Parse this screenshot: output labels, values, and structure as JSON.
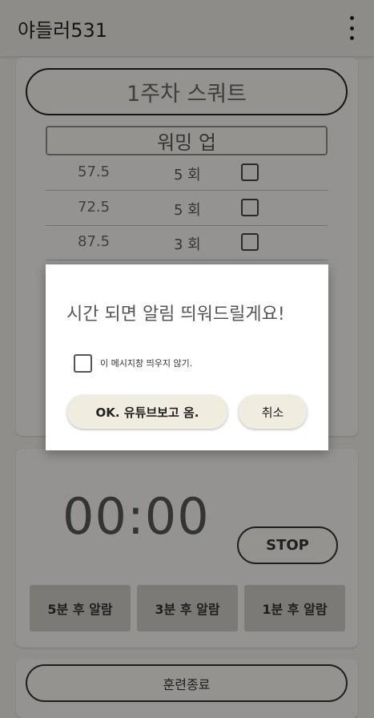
{
  "appbar": {
    "title": "야들러531",
    "menu_icon": "more-vert-icon"
  },
  "week_button": "1주차 스쿼트",
  "warmup_label": "워밍 업",
  "sets": [
    {
      "weight": "57.5",
      "reps": "5 회"
    },
    {
      "weight": "72.5",
      "reps": "5 회"
    },
    {
      "weight": "87.5",
      "reps": "3 회"
    }
  ],
  "timer": {
    "display": "00:00",
    "stop_label": "STOP"
  },
  "alarm_buttons": [
    "5분 후 알람",
    "3분 후 알람",
    "1분 후 알람"
  ],
  "end_button": "훈련종료",
  "dialog": {
    "message": "시간 되면 알림 띄워드릴게요!",
    "dont_show_label": "이 메시지창 띄우지 않기.",
    "ok_label": "OK. 유튜브보고 옴.",
    "cancel_label": "취소"
  }
}
